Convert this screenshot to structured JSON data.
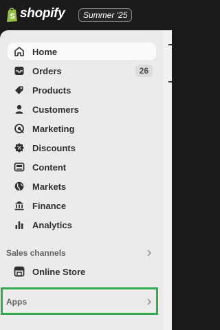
{
  "brand": {
    "name": "shopify",
    "edition": "Summer '25"
  },
  "nav": [
    {
      "id": "home",
      "label": "Home",
      "icon": "home-icon",
      "active": true
    },
    {
      "id": "orders",
      "label": "Orders",
      "icon": "orders-inbox-icon",
      "badge": "26"
    },
    {
      "id": "products",
      "label": "Products",
      "icon": "product-tag-icon"
    },
    {
      "id": "customers",
      "label": "Customers",
      "icon": "person-icon"
    },
    {
      "id": "marketing",
      "label": "Marketing",
      "icon": "target-icon"
    },
    {
      "id": "discounts",
      "label": "Discounts",
      "icon": "discount-badge-icon"
    },
    {
      "id": "content",
      "label": "Content",
      "icon": "content-image-icon"
    },
    {
      "id": "markets",
      "label": "Markets",
      "icon": "globe-icon"
    },
    {
      "id": "finance",
      "label": "Finance",
      "icon": "bank-icon"
    },
    {
      "id": "analytics",
      "label": "Analytics",
      "icon": "bar-chart-icon"
    }
  ],
  "sales_channels": {
    "title": "Sales channels",
    "items": [
      {
        "id": "online-store",
        "label": "Online Store",
        "icon": "store-icon"
      }
    ]
  },
  "apps": {
    "title": "Apps"
  },
  "colors": {
    "highlight": "#2eaa4f",
    "sidebar_bg": "#ebebeb",
    "topbar_bg": "#1a1a1a"
  }
}
